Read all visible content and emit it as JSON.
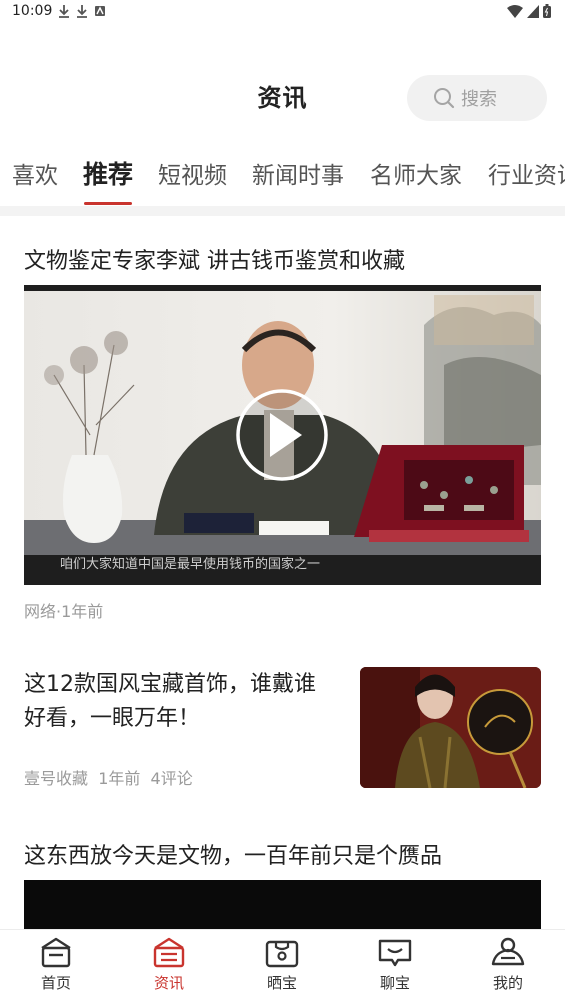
{
  "status_bar": {
    "time": "10:09"
  },
  "header": {
    "title": "资讯",
    "search_placeholder": "搜索"
  },
  "tabs": [
    {
      "label": "喜欢"
    },
    {
      "label": "推荐",
      "active": true
    },
    {
      "label": "短视频"
    },
    {
      "label": "新闻时事"
    },
    {
      "label": "名师大家"
    },
    {
      "label": "行业资讯"
    }
  ],
  "articles": [
    {
      "title": "文物鉴定专家李斌 讲古钱币鉴赏和收藏",
      "video_subtitle": "咱们大家知道中国是最早使用钱币的国家之一",
      "meta": "网络·1年前"
    },
    {
      "title": "这12款国风宝藏首饰，谁戴谁好看，一眼万年！",
      "source": "壹号收藏",
      "time": "1年前",
      "comments": "4评论"
    },
    {
      "title": "这东西放今天是文物，一百年前只是个赝品"
    }
  ],
  "bottom_nav": [
    {
      "label": "首页",
      "icon": "home-icon"
    },
    {
      "label": "资讯",
      "icon": "news-icon",
      "active": true
    },
    {
      "label": "晒宝",
      "icon": "showcase-icon"
    },
    {
      "label": "聊宝",
      "icon": "chat-icon"
    },
    {
      "label": "我的",
      "icon": "profile-icon"
    }
  ],
  "colors": {
    "accent": "#c9342e",
    "meta_text": "#9a9a9a"
  }
}
